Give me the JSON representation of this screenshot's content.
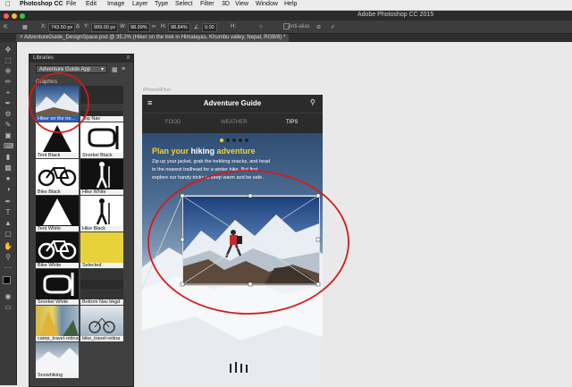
{
  "menubar": {
    "apple": "",
    "items": [
      "Photoshop CC",
      "File",
      "Edit",
      "Image",
      "Layer",
      "Type",
      "Select",
      "Filter",
      "3D",
      "View",
      "Window",
      "Help"
    ]
  },
  "window": {
    "title": "Adobe Photoshop CC 2015"
  },
  "options": {
    "x": "743.50 px",
    "y": "999.00 px",
    "w": "98.99%",
    "h": "98.84%",
    "angle": "0.00",
    "antialias": "Anti-alias"
  },
  "doc_tab": "AdventureGuide_DesignSpace.psd @ 35.2% (Hiker on the trek in Himalayas, Khumbu valley, Nepal, RGB/8) *",
  "libraries": {
    "panel_title": "Libraries",
    "library_name": "Adventure Guide App",
    "section": "Graphics",
    "items": [
      {
        "label": "Hiker on the tre..."
      },
      {
        "label": "Top Nav"
      },
      {
        "label": "Tent Black"
      },
      {
        "label": "Snorkel Black"
      },
      {
        "label": "Bike Black"
      },
      {
        "label": "Hike White"
      },
      {
        "label": "Tent White"
      },
      {
        "label": "Hike Black"
      },
      {
        "label": "Bike White"
      },
      {
        "label": "Selected"
      },
      {
        "label": "Snorkel White"
      },
      {
        "label": "Bottom Nav bkgd"
      },
      {
        "label": "camp_travel-retina"
      },
      {
        "label": "bike_travel-retina"
      },
      {
        "label": "Snowhiking"
      }
    ]
  },
  "artboard": {
    "label": "iPhone6Plus",
    "app_title": "Adventure Guide",
    "nav": [
      "FOOD",
      "WEATHER",
      "TIPS"
    ],
    "headline_a": "Plan your ",
    "headline_b": "hiking ",
    "headline_c": "adventure",
    "body_lines": [
      "Zip up your jacket, grab the trekking snacks, and head",
      "to the nearest trailhead for a winter hike. But first",
      "explore our handy tricks to keep warm and be safe."
    ]
  },
  "colors": {
    "accent_yellow": "#f2d230",
    "annotation_red": "#d61a1a",
    "selected_yellow": "#e8d23a"
  }
}
